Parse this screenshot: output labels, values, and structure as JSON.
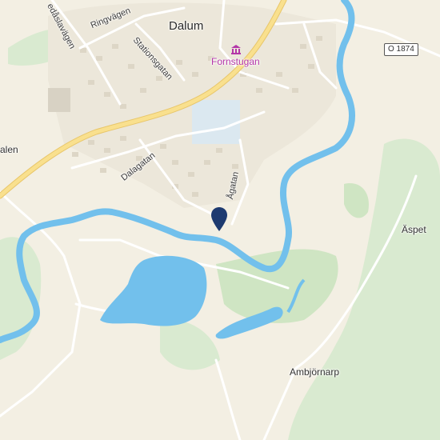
{
  "map": {
    "colors": {
      "land": "#f3efe3",
      "green": "#d9ead0",
      "green_dark": "#cfe5c3",
      "water": "#72c0ec",
      "road_major": "#f9e08e",
      "road_minor": "#ffffff",
      "buildings": "#e2ddd0",
      "pin": "#1d3a70",
      "poi": "#b436a8"
    },
    "labels": {
      "town": "Dalum",
      "poi": "Fornstugan",
      "road_shield": "O 1874",
      "place_1": "Äspet",
      "place_2": "Ambjörnarp",
      "street_1": "Ringvägen",
      "street_2": "Stationsgatan",
      "street_3": "Dalagatan",
      "street_4": "Ågatan",
      "street_5": "edåslavägen",
      "street_6": "alen"
    },
    "icons": {
      "pin": "location-pin-icon",
      "poi": "museum-icon"
    }
  }
}
